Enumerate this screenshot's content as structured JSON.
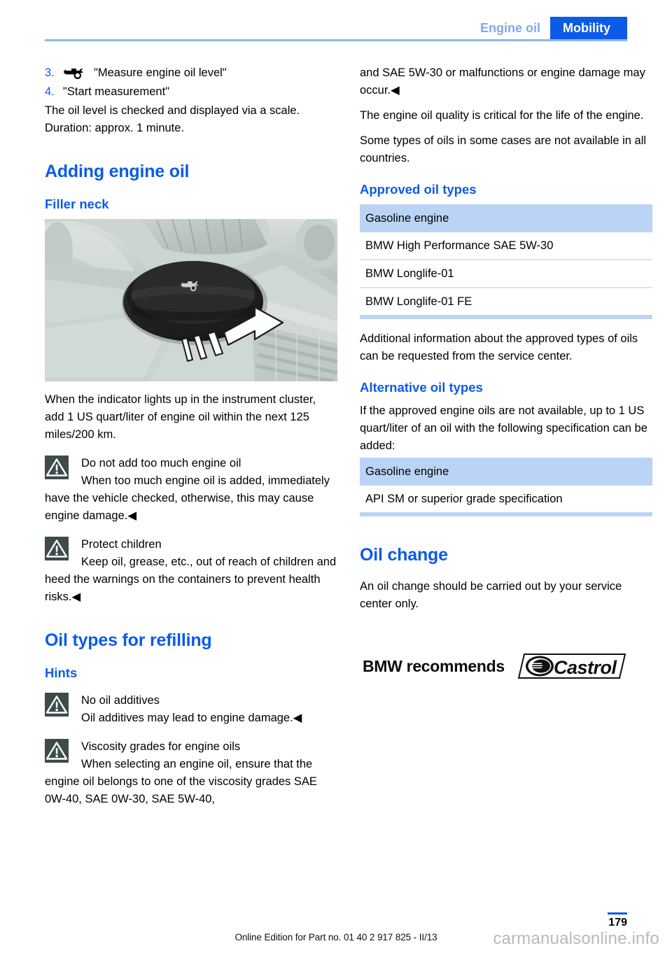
{
  "header": {
    "inactive_tab": "Engine oil",
    "active_tab": "Mobility",
    "accent_color": "#0B5BE8",
    "inactive_color": "#7FA9EE"
  },
  "left_column": {
    "steps": [
      {
        "number": "3.",
        "icon": "oil-can-icon",
        "text": "\"Measure engine oil level\""
      },
      {
        "number": "4.",
        "icon": "",
        "text": "\"Start measurement\""
      }
    ],
    "after_steps": [
      "The oil level is checked and displayed via a scale.",
      "Duration: approx. 1 minute."
    ],
    "section_adding": "Adding engine oil",
    "sub_filler_neck": "Filler neck",
    "figure_caption_alt": "engine-oil-filler-cap-photo",
    "para_indicator": "When the indicator lights up in the instrument cluster, add 1 US quart/liter of engine oil within the next 125 miles/200 km.",
    "warnings": [
      {
        "title": "Do not add too much engine oil",
        "body": "When too much engine oil is added, immediately have the vehicle checked, otherwise, this may cause engine damage.◀"
      },
      {
        "title": "Protect children",
        "body": "Keep oil, grease, etc., out of reach of children and heed the warnings on the containers to prevent health risks.◀"
      }
    ],
    "section_oil_types": "Oil types for refilling",
    "sub_hints": "Hints",
    "hints": [
      {
        "title": "No oil additives",
        "body": "Oil additives may lead to engine damage.◀"
      },
      {
        "title": "Viscosity grades for engine oils",
        "body": "When selecting an engine oil, ensure that the engine oil belongs to one of the viscosity grades SAE 0W-40, SAE 0W-30, SAE 5W-40,"
      }
    ]
  },
  "right_column": {
    "continuation": "and SAE 5W-30 or malfunctions or engine damage may occur.◀",
    "para_quality": "The engine oil quality is critical for the life of the engine.",
    "para_availability": "Some types of oils in some cases are not available in all countries.",
    "sub_approved": "Approved oil types",
    "approved_table": {
      "header": "Gasoline engine",
      "rows": [
        "BMW High Performance SAE 5W-30",
        "BMW Longlife-01",
        "BMW Longlife-01 FE"
      ]
    },
    "para_additional": "Additional information about the approved types of oils can be requested from the service center.",
    "sub_alternative": "Alternative oil types",
    "para_alternative": "If the approved engine oils are not available, up to 1 US quart/liter of an oil with the following specification can be added:",
    "alternative_table": {
      "header": "Gasoline engine",
      "rows": [
        "API SM or superior grade specification"
      ]
    },
    "section_oil_change": "Oil change",
    "para_oil_change": "An oil change should be carried out by your service center only.",
    "recommends_text": "BMW recommends",
    "brand_logo": "castrol-logo"
  },
  "footer": {
    "page_number": "179",
    "edition_note": "Online Edition for Part no. 01 40 2 917 825 - II/13",
    "watermark": "carmanualsonline.info"
  }
}
